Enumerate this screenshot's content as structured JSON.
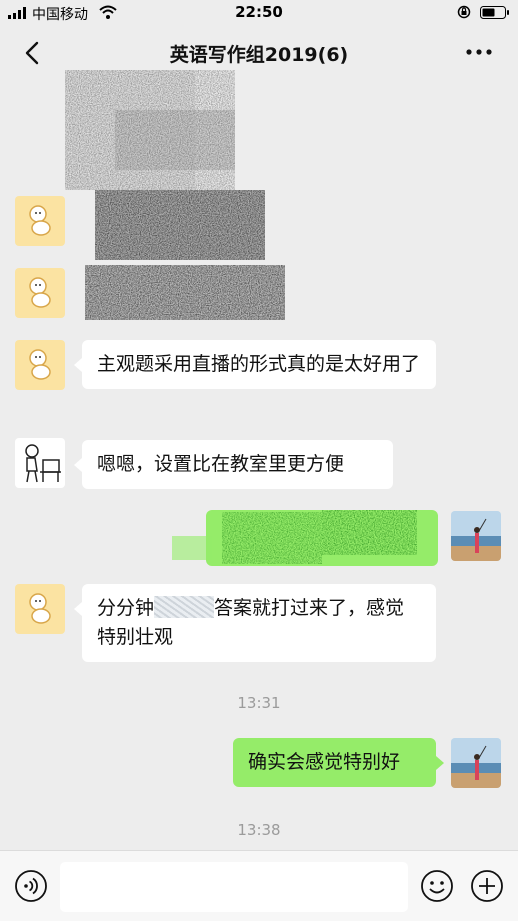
{
  "status_bar": {
    "carrier": "中国移动",
    "time": "22:50"
  },
  "nav": {
    "title": "英语写作组2019(6)"
  },
  "messages": [
    {
      "side": "left",
      "text": "主观题采用直播的形式真的是太好用了"
    },
    {
      "side": "left",
      "text": "嗯嗯，设置比在教室里更方便"
    },
    {
      "side": "left",
      "text_before": "分分钟",
      "text_after": "答案就打过来了，感觉特别壮观"
    },
    {
      "side": "right",
      "text": "确实会感觉特别好"
    }
  ],
  "timestamps": [
    "13:31",
    "13:38"
  ],
  "colors": {
    "background": "#ededed",
    "bubble_self": "#95ec69",
    "bubble_other": "#ffffff",
    "avatar_yellow": "#fbe3a2"
  },
  "icons": [
    "back-icon",
    "more-icon",
    "voice-icon",
    "emoji-icon",
    "plus-icon"
  ]
}
